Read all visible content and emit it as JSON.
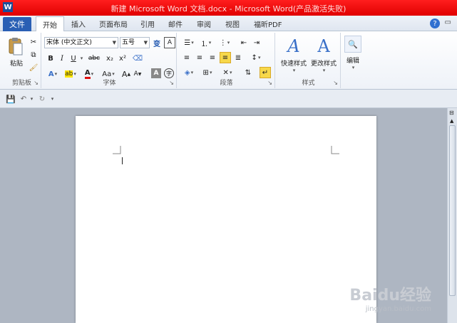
{
  "window": {
    "title": "新建 Microsoft Word 文档.docx - Microsoft Word(产品激活失败)",
    "help_glyph": "?",
    "minimize_ribbon_glyph": "▭"
  },
  "tabs": {
    "file": "文件",
    "items": [
      "开始",
      "插入",
      "页面布局",
      "引用",
      "邮件",
      "审阅",
      "视图",
      "福昕PDF"
    ]
  },
  "ribbon": {
    "clipboard": {
      "label": "剪贴板",
      "paste": "粘贴"
    },
    "font": {
      "label": "字体",
      "font_name": "宋体 (中文正文)",
      "font_size": "五号",
      "bold": "B",
      "italic": "I",
      "underline": "U",
      "strike": "abc",
      "subscript": "x₂",
      "superscript": "x²",
      "grow": "A",
      "shrink": "A",
      "case": "Aa",
      "font_color": "A",
      "highlight": "ab",
      "effects": "A"
    },
    "paragraph": {
      "label": "段落"
    },
    "styles": {
      "label": "样式",
      "quick_styles": "快速样式",
      "change_styles": "更改样式"
    },
    "editing": {
      "label": "编辑"
    }
  },
  "watermark": {
    "line1": "Baidu经验",
    "line2": "jingyan.baidu.com"
  },
  "colors": {
    "titlebar": "#e00000",
    "file_tab": "#2a5fb4",
    "accent_highlight": "#f7d84a"
  }
}
